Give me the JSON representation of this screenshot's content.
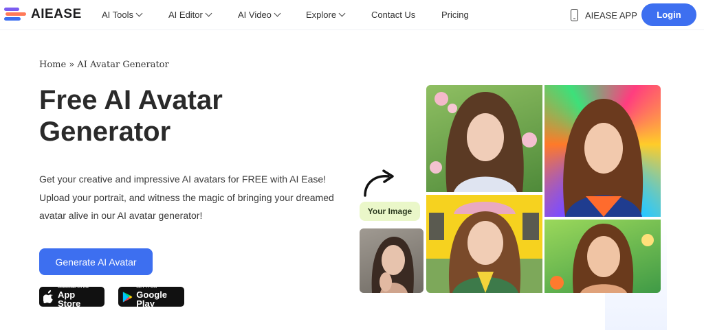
{
  "header": {
    "logo_text": "AIEASE",
    "nav": [
      {
        "label": "AI Tools",
        "dropdown": true
      },
      {
        "label": "AI Editor",
        "dropdown": true
      },
      {
        "label": "AI Video",
        "dropdown": true
      },
      {
        "label": "Explore",
        "dropdown": true
      },
      {
        "label": "Contact Us",
        "dropdown": false
      },
      {
        "label": "Pricing",
        "dropdown": false
      }
    ],
    "app_label": "AIEASE APP",
    "app_icon": "phone-icon",
    "login_label": "Login"
  },
  "hero": {
    "breadcrumb": "Home » AI Avatar Generator",
    "title": "Free AI Avatar Generator",
    "description": "Get your creative and impressive AI avatars for FREE with AI Ease! Upload your portrait, and witness the magic of bringing your dreamed avatar alive in our AI avatar generator!",
    "cta_label": "Generate AI Avatar",
    "app_store": {
      "small": "Download on the",
      "big": "App Store"
    },
    "google_play": {
      "small": "GET IT ON",
      "big": "Google Play"
    },
    "your_image_label": "Your Image"
  },
  "colors": {
    "accent": "#3d6ff0",
    "logo_bars": [
      "#7b5cf0",
      "#ff7a59",
      "#3d6ff0"
    ],
    "label_bg": "#eaf7c9"
  }
}
